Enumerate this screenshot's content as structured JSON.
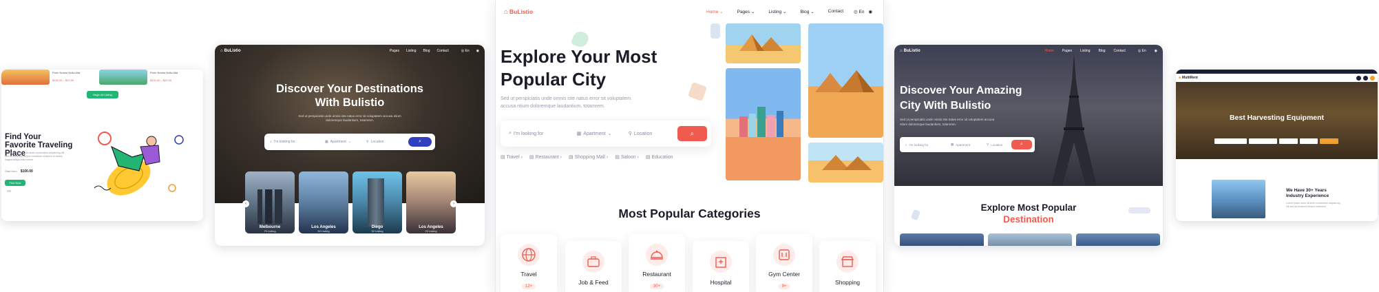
{
  "colors": {
    "brand": "#f05a4f",
    "green": "#22b573",
    "navy": "#3040a0",
    "orange": "#f0a030"
  },
  "left_card": {
    "product_strip": [
      {
        "name": "Proin Nostra Nulla Alta",
        "price": "$100.00 – $20.00"
      },
      {
        "name": "Proin Nostra Nulla Alta",
        "price": "$100.00 – $20.00"
      }
    ],
    "add_button": "Begin At Listing",
    "heading": "Find Your Favorite Traveling Place",
    "body": "Lorem ipsum dolor sit amet consectetur adipisicing elit sed do eiusmod tempor incididunt ut labore et dolore magna aliqua enim minim",
    "price_label": "Start from",
    "price": "$100.00",
    "cta": "Find Now"
  },
  "card2": {
    "logo": "BuListio",
    "nav": [
      "Pages",
      "Listing",
      "Blog",
      "Contact"
    ],
    "lang": "En",
    "title": "Discover Your Destinations With Bulistio",
    "subtitle": "Sed ut perspiciatis unde omnis iste natus error sit voluptatem accusa ntium doloremque laudantium, totamrem.",
    "search": {
      "f1": "I'm looking for",
      "f2": "Apartment",
      "f3": "Location"
    },
    "cities": [
      {
        "name": "Melbourne",
        "count": "70 Listing"
      },
      {
        "name": "Los Angeles",
        "count": "54 Listing"
      },
      {
        "name": "Diego",
        "count": "32 Listing"
      },
      {
        "name": "Los Angeles",
        "count": "23 Listing"
      }
    ]
  },
  "card3": {
    "logo": "BuListio",
    "nav": [
      "Home",
      "Pages",
      "Listing",
      "Blog",
      "Contact"
    ],
    "lang": "En",
    "title_line1": "Explore Your Most",
    "title_line2": "Popular City",
    "subtitle": "Sed ut perspiciatis unde omnis iste natus error sit voluptatem accusa ntium doloremque laudantium, totamrem.",
    "search": {
      "f1": "I'm looking for",
      "f2": "Apartment",
      "f3": "Location"
    },
    "quick": [
      "Travel",
      "Restaurant",
      "Shopping Mall",
      "Saloon",
      "Education"
    ],
    "section_title": "Most Popular Categories",
    "categories": [
      {
        "name": "Travel",
        "badge": "12+"
      },
      {
        "name": "Job & Feed",
        "badge": ""
      },
      {
        "name": "Restaurant",
        "badge": "30+"
      },
      {
        "name": "Hospital",
        "badge": ""
      },
      {
        "name": "Gym Center",
        "badge": "9+"
      },
      {
        "name": "Shopping",
        "badge": ""
      }
    ]
  },
  "card4": {
    "logo": "BuListio",
    "nav": [
      "Home",
      "Pages",
      "Listing",
      "Blog",
      "Contact"
    ],
    "lang": "En",
    "title": "Discover Your Amazing City With Bulistio",
    "subtitle": "Sed ut perspiciatis unde omnis iste natus error sit voluptatem accusa ntium doloremque laudantium, totamrem.",
    "search": {
      "f1": "I'm looking for",
      "f2": "Apartment",
      "f3": "Location"
    },
    "section_title": "Explore Most Popular",
    "section_accent": "Destination"
  },
  "card5": {
    "logo": "MultiRent",
    "hero_title": "Best Harvesting Equipment",
    "about_title": "We Have 30+ Years Industry Experience",
    "about_body": "Lorem ipsum dolor sit amet consectetur adipisicing elit sed do eiusmod tempor incididunt"
  }
}
